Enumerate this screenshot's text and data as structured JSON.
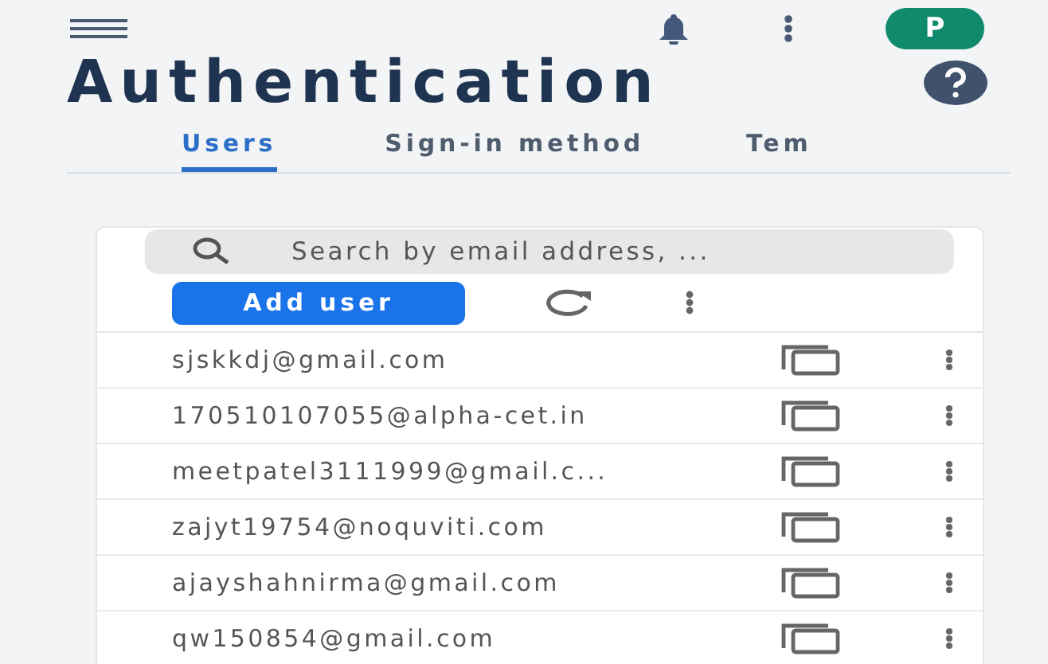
{
  "avatar": {
    "initial": "P"
  },
  "title": "Authentication",
  "tabs": [
    {
      "label": "Users",
      "selected": true
    },
    {
      "label": "Sign-in method",
      "selected": false
    },
    {
      "label": "Tem",
      "selected": false
    }
  ],
  "search": {
    "placeholder": "Search by email address, ..."
  },
  "add_button": "Add user",
  "users": [
    {
      "email": "sjskkdj@gmail.com"
    },
    {
      "email": "170510107055@alpha-cet.in"
    },
    {
      "email": "meetpatel3111999@gmail.c..."
    },
    {
      "email": "zajyt19754@noquviti.com"
    },
    {
      "email": "ajayshahnirma@gmail.com"
    },
    {
      "email": "qw150854@gmail.com"
    }
  ]
}
